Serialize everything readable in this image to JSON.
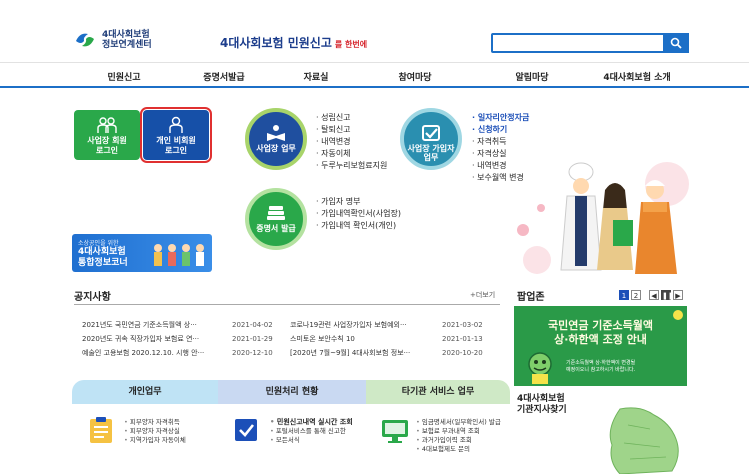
{
  "header": {
    "logo_line1": "4대사회보험",
    "logo_line2": "정보연계센터",
    "slogan_main": "4대사회보험 민원신고",
    "slogan_suffix": "를 한번에",
    "search_placeholder": ""
  },
  "gnb": [
    "민원신고",
    "증명서발급",
    "자료실",
    "참여마당",
    "알림마당",
    "4대사회보험 소개"
  ],
  "login": {
    "biz_line1": "사업장 회원",
    "biz_line2": "로그인",
    "indiv_line1": "개인 비회원",
    "indiv_line2": "로그인"
  },
  "circles": {
    "biz": "사업장 업무",
    "join_line1": "사업장 가입자",
    "join_line2": "업무",
    "cert": "증명서 발급"
  },
  "lists": {
    "biz": [
      "성립신고",
      "탈퇴신고",
      "내역변경",
      "자동이체",
      "두루누리보험료지원"
    ],
    "join_hl1": "일자리안정자금",
    "join_hl2": "신청하기",
    "join": [
      "자격취득",
      "자격상실",
      "내역변경",
      "보수월액 변경"
    ],
    "cert": [
      "가입자 명부",
      "가입내역확인서(사업장)",
      "가입내역 확인서(개인)"
    ]
  },
  "portal_banner": {
    "small": "소상공인을 위한",
    "line1": "4대사회보험",
    "line2": "통합정보코너"
  },
  "notice": {
    "title": "공지사항",
    "more": "+더보기",
    "rows": [
      {
        "t1": "2021년도 국민연금 기준소득월액 상···",
        "d1": "2021-04-02",
        "t2": "코로나19관련 사업장가입자 보험예외···",
        "d2": "2021-03-02"
      },
      {
        "t1": "2020년도 귀속 직장가입자 보험료 연···",
        "d1": "2021-01-29",
        "t2": "스미토온 보안수칙 10",
        "d2": "2021-01-13"
      },
      {
        "t1": "예술인 고용보험 2020.12.10. 시행 안···",
        "d1": "2020-12-10",
        "t2": "[2020년 7월~9월] 4대사회보험 정보···",
        "d2": "2020-10-20"
      }
    ]
  },
  "popup": {
    "title": "팝업존",
    "page1": "1",
    "page2": "2",
    "banner_line1": "국민연금 기준소득월액",
    "banner_line2": "상·하한액 조정 안내",
    "banner_sub1": "기준소득월액 상·하한액이 변경될",
    "banner_sub2": "예정이오니 참고하시기 바랍니다."
  },
  "bottom": {
    "tab1": "개인업무",
    "tab2": "민원처리 현황",
    "tab3": "타기관 서비스 업무",
    "sec1": [
      "피부양자 자격취득",
      "피부양자 자격상실",
      "지역가입자 자동이체"
    ],
    "sec2_title": "민원신고내역 실시간 조회",
    "sec2": [
      "포털서비스를 통해 신고한",
      "모든서식"
    ],
    "sec3": [
      "임금명세서(일부확인서) 발급",
      "보험료 부과내역 조회",
      "과거가입이력 조회",
      "4대보험제도 문의"
    ],
    "branch_line1": "4대사회보험",
    "branch_line2": "기관지사찾기"
  }
}
